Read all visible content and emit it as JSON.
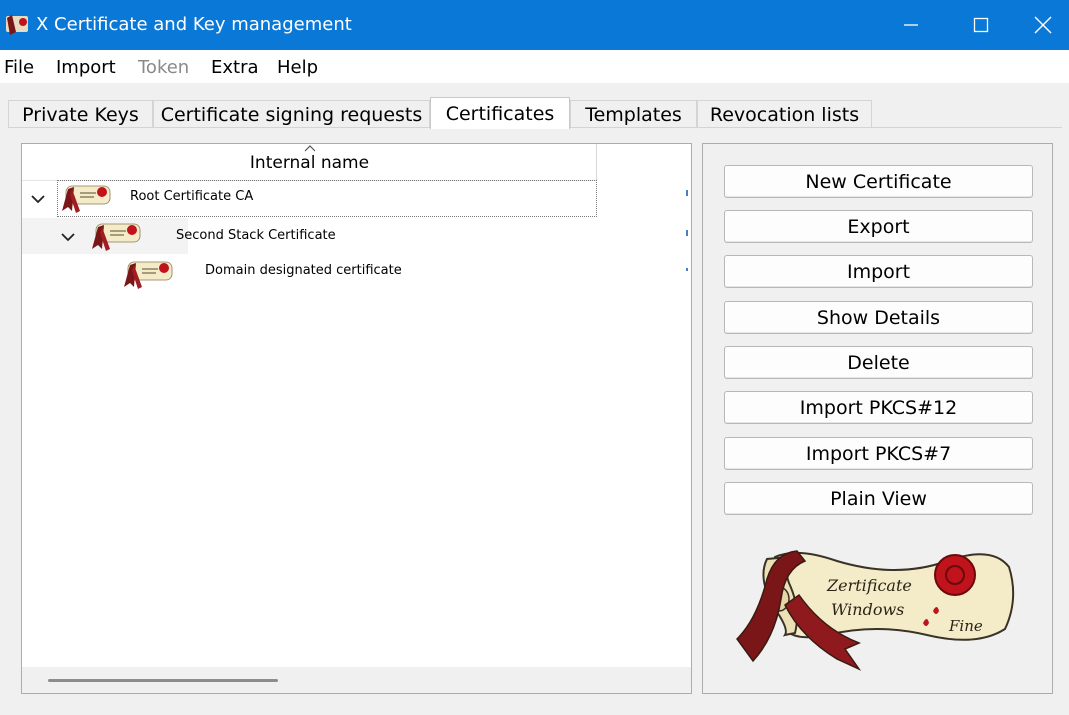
{
  "window": {
    "title": "X Certificate and Key management",
    "controls": {
      "minimize": "minimize",
      "maximize": "maximize",
      "close": "close"
    }
  },
  "menu": [
    {
      "label": "File",
      "enabled": true
    },
    {
      "label": "Import",
      "enabled": true
    },
    {
      "label": "Token",
      "enabled": false
    },
    {
      "label": "Extra",
      "enabled": true
    },
    {
      "label": "Help",
      "enabled": true
    }
  ],
  "tabs": [
    {
      "label": "Private Keys",
      "active": false
    },
    {
      "label": "Certificate signing requests",
      "active": false
    },
    {
      "label": "Certificates",
      "active": true
    },
    {
      "label": "Templates",
      "active": false
    },
    {
      "label": "Revocation lists",
      "active": false
    }
  ],
  "tree": {
    "column_header": "Internal name",
    "sort_indicator": "ascending",
    "rows": [
      {
        "label": "Root Certificate CA",
        "level": 0,
        "expanded": true,
        "icon": "certificate-scroll-icon"
      },
      {
        "label": "Second Stack Certificate",
        "level": 1,
        "expanded": true,
        "icon": "certificate-scroll-icon"
      },
      {
        "label": "Domain designated certificate",
        "level": 2,
        "expanded": false,
        "icon": "certificate-scroll-icon"
      }
    ]
  },
  "buttons": [
    {
      "label": "New Certificate"
    },
    {
      "label": "Export"
    },
    {
      "label": "Import"
    },
    {
      "label": "Show Details"
    },
    {
      "label": "Delete"
    },
    {
      "label": "Import PKCS#12"
    },
    {
      "label": "Import PKCS#7"
    },
    {
      "label": "Plain View"
    }
  ],
  "logo": {
    "icon": "certificate-scroll-logo",
    "text": "Zertificate Windows Fine"
  },
  "colors": {
    "titlebar": "#0a78d7",
    "seal": "#c0131b",
    "ribbon": "#7a1518",
    "parchment": "#f4ecc8"
  }
}
